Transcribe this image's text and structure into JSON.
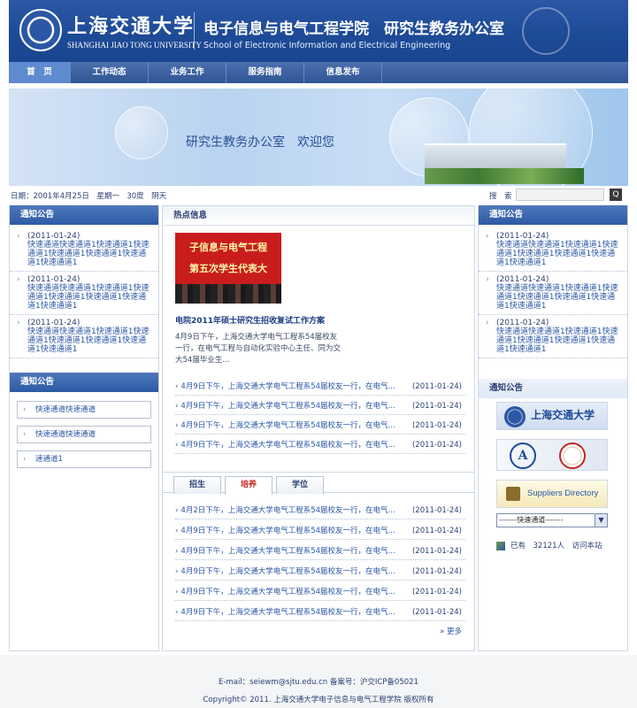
{
  "header": {
    "logo_cn": "上海交通大学",
    "logo_en": "SHANGHAI JIAO TONG UNIVERSITY",
    "title": "电子信息与电气工程学院　研究生教务办公室",
    "subtitle": "School of Electronic Information and Electrical Engineering"
  },
  "nav": {
    "items": [
      "首　页",
      "工作动态",
      "业务工作",
      "服务指南",
      "信息发布"
    ],
    "active": 0
  },
  "banner": {
    "text": "研究生教务办公室　欢迎您"
  },
  "infobar": {
    "date": "日期：2001年4月25日　星期一　30度　阴天",
    "search_label": "搜　索",
    "search_value": "",
    "search_button": "Q"
  },
  "left": {
    "notice_title": "通知公告",
    "notices": [
      {
        "date": "(2011-01-24)",
        "text": "快速通道快速通道1快速通道1快速通道1快速通道1快速通道1快速通道1快速通道1"
      },
      {
        "date": "(2011-01-24)",
        "text": "快速通道快速通道1快速通道1快速通道1快速通道1快速通道1快速通道1快速通道1"
      },
      {
        "date": "(2011-01-24)",
        "text": "快速通道快速通道1快速通道1快速通道1快速通道1快速通道1快速通道1快速通道1"
      }
    ],
    "quick_title": "通知公告",
    "quick_links": [
      "快速通道快速通道",
      "快速通道快速通道",
      "速通道1"
    ]
  },
  "middle": {
    "hot_title": "热点信息",
    "feature_img_line1": "子信息与电气工程",
    "feature_img_line2": "第五次学生代表大",
    "feature_title": "电院2011年硕士研究生招收复试工作方案",
    "feature_desc": "4月9日下午，上海交通大学电气工程系54届校友一行，在电气工程与自动化实验中心主任、同为交大54届毕业生...",
    "news": [
      {
        "text": "4月9日下午，上海交通大学电气工程系54届校友一行，在电气...",
        "date": "(2011-01-24)"
      },
      {
        "text": "4月9日下午，上海交通大学电气工程系54届校友一行，在电气...",
        "date": "(2011-01-24)"
      },
      {
        "text": "4月9日下午，上海交通大学电气工程系54届校友一行，在电气...",
        "date": "(2011-01-24)"
      },
      {
        "text": "4月9日下午，上海交通大学电气工程系54届校友一行，在电气...",
        "date": "(2011-01-24)"
      }
    ],
    "tabs": [
      "招生",
      "培养",
      "学位"
    ],
    "active_tab": 1,
    "tab_news": [
      {
        "text": "4月2日下午，上海交通大学电气工程系54届校友一行，在电气...",
        "date": "(2011-01-24)"
      },
      {
        "text": "4月9日下午，上海交通大学电气工程系54届校友一行，在电气...",
        "date": "(2011-01-24)"
      },
      {
        "text": "4月9日下午，上海交通大学电气工程系54届校友一行，在电气...",
        "date": "(2011-01-24)"
      },
      {
        "text": "4月9日下午，上海交通大学电气工程系54届校友一行，在电气...",
        "date": "(2011-01-24)"
      },
      {
        "text": "4月9日下午，上海交通大学电气工程系54届校友一行，在电气...",
        "date": "(2011-01-24)"
      },
      {
        "text": "4月9日下午，上海交通大学电气工程系54届校友一行，在电气...",
        "date": "(2011-01-24)"
      }
    ],
    "more": "» 更多"
  },
  "right": {
    "notice_title": "通知公告",
    "notices": [
      {
        "date": "(2011-01-24)",
        "text": "快速通道快速通道1快速通道1快速通道1快速通道1快速通道1快速通道1快速通道1"
      },
      {
        "date": "(2011-01-24)",
        "text": "快速通道快速通道1快速通道1快速通道1快速通道1快速通道1快速通道1快速通道1"
      },
      {
        "date": "(2011-01-24)",
        "text": "快速通道快速通道1快速通道1快速通道1快速通道1快速通道1快速通道1快速通道1"
      }
    ],
    "links_title": "通知公告",
    "sjtu_logo_text": "上海交通大学",
    "seal_letter": "A",
    "suppliers_text": "Suppliers Directory",
    "select_value": "-------快速通道-------",
    "visit_text": "已有　32121人　访问本站"
  },
  "footer": {
    "line1": "E-mail：seiewm@sjtu.edu.cn 备案号：沪交ICP备05021",
    "line2": "Copyright© 2011. 上海交通大学电子信息与电气工程学院 版权所有"
  }
}
